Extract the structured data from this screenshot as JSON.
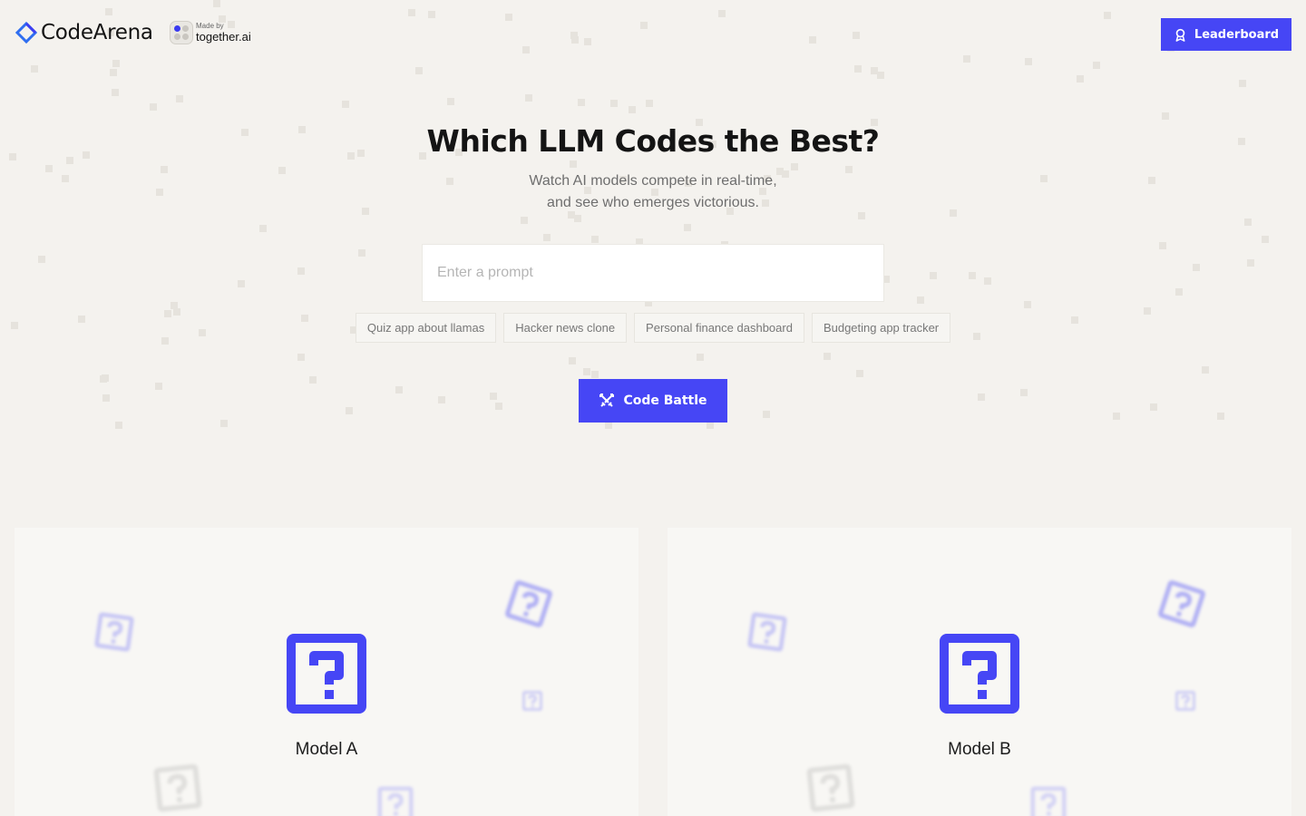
{
  "header": {
    "logo_text": "CodeArena",
    "made_by_label": "Made by",
    "made_by_brand": "together.ai",
    "leaderboard_label": "Leaderboard"
  },
  "hero": {
    "title": "Which LLM Codes the Best?",
    "subtitle": "Watch AI models compete in real-time, and see who emerges victorious."
  },
  "prompt": {
    "placeholder": "Enter a prompt",
    "value": ""
  },
  "suggestions": [
    "Quiz app about llamas",
    "Hacker news clone",
    "Personal finance dashboard",
    "Budgeting app tracker"
  ],
  "battle_button_label": "Code Battle",
  "models": {
    "a": {
      "label": "Model A"
    },
    "b": {
      "label": "Model B"
    }
  },
  "colors": {
    "accent": "#4646f5",
    "background": "#f4f2ee",
    "panel": "#f8f7f4"
  },
  "icons": {
    "logo": "diamond-logo-icon",
    "leaderboard": "award-icon",
    "battle": "crossed-swords-icon",
    "model": "question-box-icon"
  }
}
